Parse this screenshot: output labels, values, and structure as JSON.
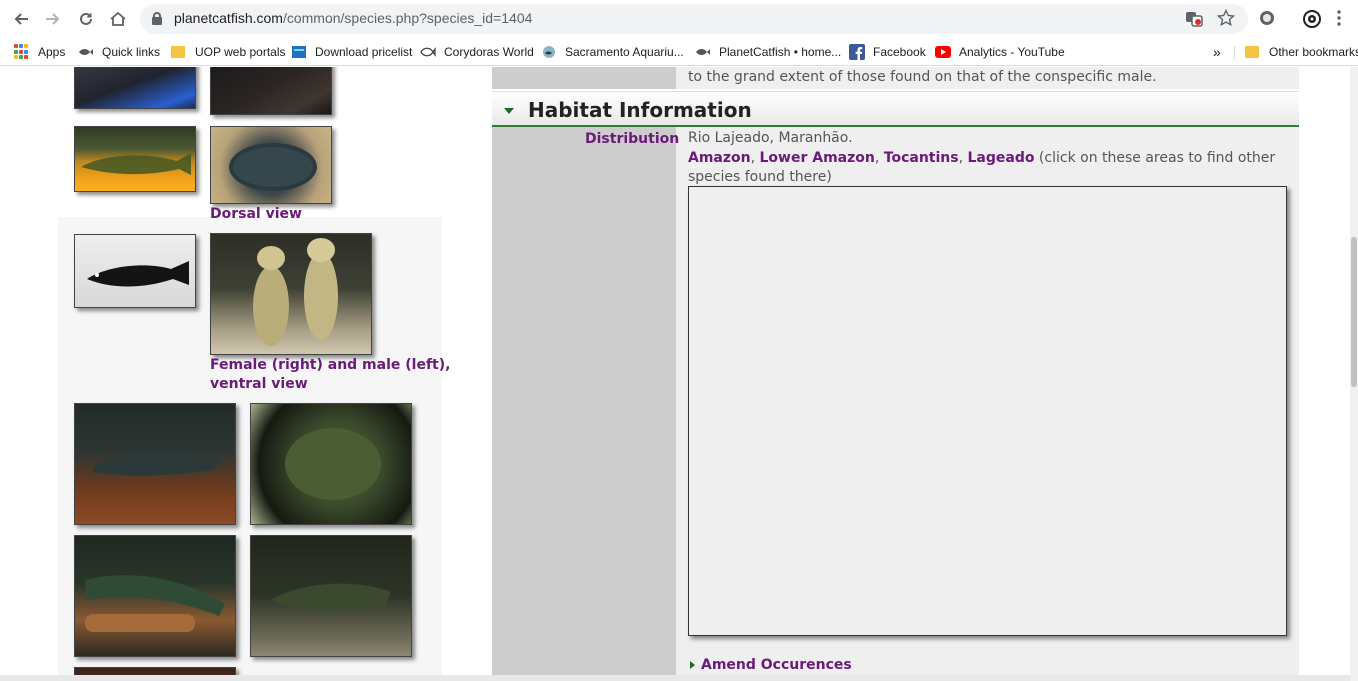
{
  "browser": {
    "url_host": "planetcatfish.com",
    "url_path": "/common/species.php?species_id=1404",
    "bookmarks": [
      {
        "label": "Apps"
      },
      {
        "label": "Quick links"
      },
      {
        "label": "UOP web portals"
      },
      {
        "label": "Download pricelist"
      },
      {
        "label": "Corydoras World"
      },
      {
        "label": "Sacramento Aquariu..."
      },
      {
        "label": "PlanetCatfish • home..."
      },
      {
        "label": "Facebook"
      },
      {
        "label": "Analytics - YouTube"
      }
    ],
    "overflow_label": "»",
    "other_bookmarks": "Other bookmarks"
  },
  "gallery": {
    "captions": {
      "dorsal": "Dorsal view",
      "female_male_line1": "Female (right) and male (left),",
      "female_male_line2": "ventral view"
    }
  },
  "sections": {
    "prev_text": "to the grand extent of those found on that of the conspecific male.",
    "habitat_title": "Habitat Information",
    "distribution_label": "Distribution",
    "distribution_text": "Rio Lajeado, Maranhão.",
    "areas": [
      "Amazon",
      "Lower Amazon",
      "Tocantins",
      "Lageado"
    ],
    "areas_sep": ", ",
    "areas_note": " (click on these areas to find other species found there)",
    "amend_label": "Amend Occurences"
  },
  "colors": {
    "link_purple": "#6b1a7a",
    "header_green": "#2e7d32"
  }
}
